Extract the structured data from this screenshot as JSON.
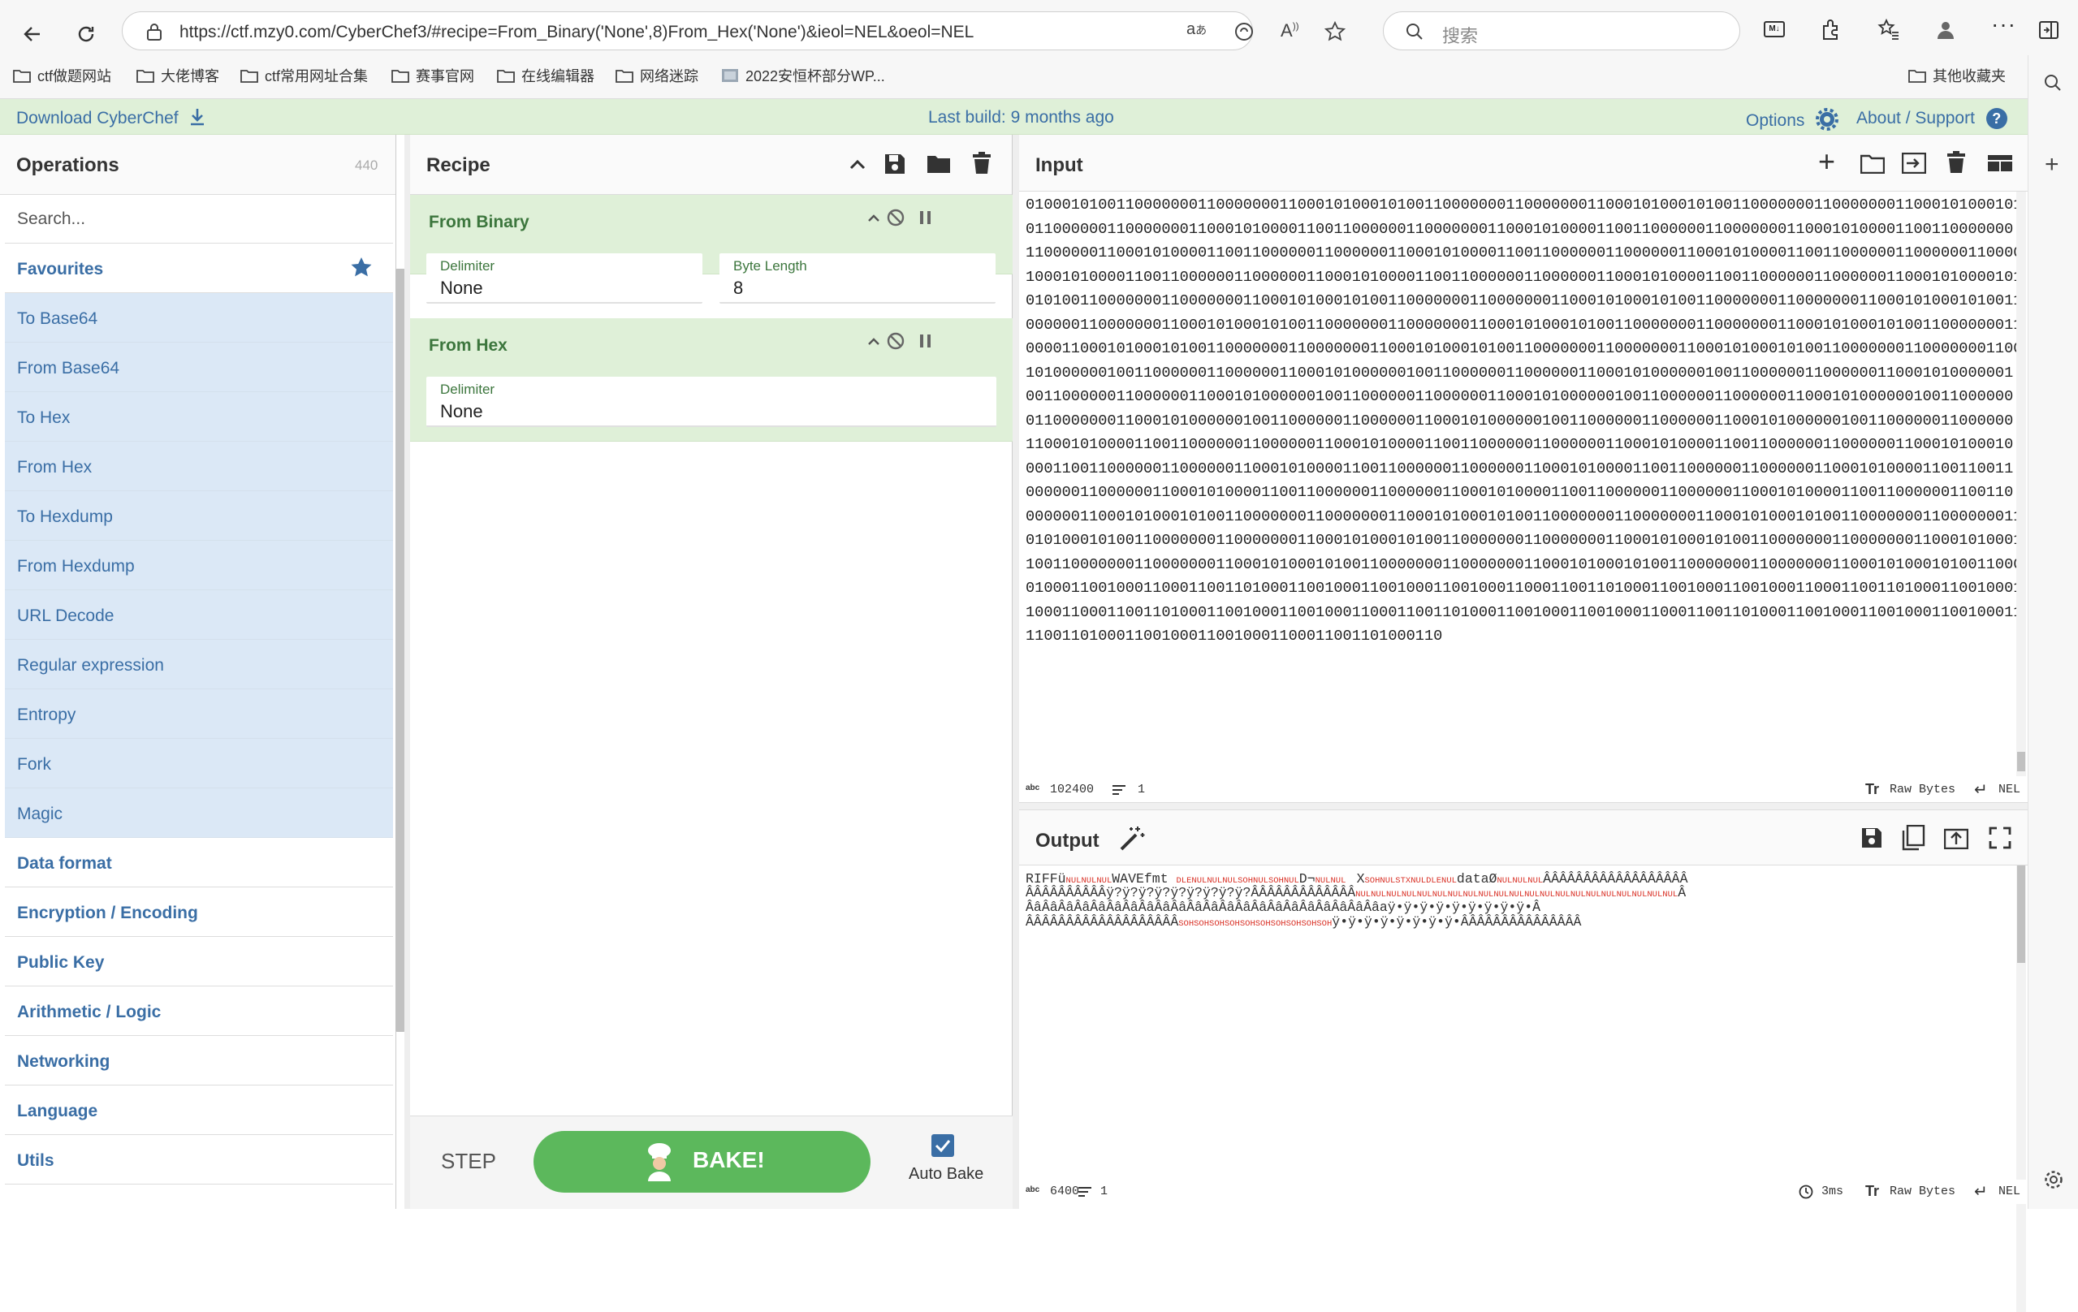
{
  "browser": {
    "url": "https://ctf.mzy0.com/CyberChef3/#recipe=From_Binary('None',8)From_Hex('None')&ieol=NEL&oeol=NEL",
    "search_placeholder": "搜索",
    "bookmarks": [
      "ctf做题网站",
      "大佬博客",
      "ctf常用网址合集",
      "赛事官网",
      "在线编辑器",
      "网络迷踪",
      "2022安恒杯部分WP..."
    ],
    "other_bookmarks": "其他收藏夹"
  },
  "banner": {
    "download": "Download CyberChef",
    "build": "Last build: 9 months ago",
    "options": "Options",
    "about": "About / Support"
  },
  "operations": {
    "title": "Operations",
    "count": "440",
    "search_placeholder": "Search...",
    "favourites": "Favourites",
    "items": [
      "To Base64",
      "From Base64",
      "To Hex",
      "From Hex",
      "To Hexdump",
      "From Hexdump",
      "URL Decode",
      "Regular expression",
      "Entropy",
      "Fork",
      "Magic"
    ],
    "categories": [
      "Data format",
      "Encryption / Encoding",
      "Public Key",
      "Arithmetic / Logic",
      "Networking",
      "Language",
      "Utils"
    ]
  },
  "recipe": {
    "title": "Recipe",
    "ops": [
      {
        "name": "From Binary",
        "fields": [
          {
            "label": "Delimiter",
            "value": "None"
          },
          {
            "label": "Byte Length",
            "value": "8"
          }
        ]
      },
      {
        "name": "From Hex",
        "fields": [
          {
            "label": "Delimiter",
            "value": "None"
          }
        ]
      }
    ],
    "step": "STEP",
    "bake": "BAKE!",
    "auto_bake": "Auto Bake"
  },
  "input": {
    "title": "Input",
    "lines": [
      "0100010100110000000110000000110001010001010011000000011000000011000101000101001100000001100000001100010100010100",
      "0110000001100000001100010100001100110000001100000001100010100001100110000001100000001100010100001100110000000",
      "1100000011000101000011001100000011000000110001010000110011000000110000001100010100001100110000001100000011000001",
      "1000101000011001100000011000000110001010000110011000000110000001100010100001100110000001100000011000101000010100",
      "0101001100000001100000001100010100010100110000000110000000110001010001010011000000011000000011000101000101001100110",
      "0000001100000001100010100010100110000000110000000110001010001010011000000011000000011000101000101001100000001100",
      "0000110001010001010011000000011000000011000101000101001100000001100000001100010100010100110000000110000000110000",
      "1010000001001100000011000000110001010000001001100000011000000110001010000001001100000011000000110001010000001",
      "0011000000110000001100010100000010011000000110000001100010100000010011000000110000001100010100000010011000000",
      "0110000000110001010000001001100000011000000110001010000001001100000011000000110001010000001001100000011000000",
      "1100010100001100110000001100000011000101000011001100000011000000110001010000110011000000110000001100010100010",
      "0001100110000001100000011000101000011001100000011000000110001010000110011000000110000001100010100001100110011",
      "0000001100000011000101000011001100000011000000110001010000110011000000110000001100010100001100110000001100110",
      "0000001100010100010100110000000110000000110001010001010011000000011000000011000101000101001100000001100000001100",
      "0101000101001100000001100000001100010100010100110000000110000000110001010001010011000000011000000011000101000100110",
      "1001100000001100000001100010100010100110000000110000000110001010001010011000000011000000011000101000101001100000",
      "0100011001000110001100110100011001000110010001100100011000110011010001100100011001000110001100110100011001000110",
      "1000110001100110100011001000110010001100011001101000110010001100100011000110011010001100100011001000110010001100",
      "1100110100011001000110010001100011001101000110"
    ],
    "length": "102400",
    "lines_count": "1",
    "raw_bytes": "Raw Bytes",
    "eol": "NEL"
  },
  "output": {
    "title": "Output",
    "lines": [
      "RIFFü\u0000\u0000\u0000WAVEfmt \u0010\u0000\u0000\u0000\u0001\u0000\u0001\u0000D¬\u0000\u0000X\u0001\u0000\u0002\u0000\u0010\u0000dataØ\u0000\u0000\u0000ÂÂÂÂÂÂÂÂÂÂÂÂÂÂÂÂÂÂ",
      "ÂÂÂÂÂÂÂÂÂÂÿ?ÿ?ÿ?ÿ?ÿ?ÿ?ÿ?ÿ?ÿ?ÂÂÂÂÂÂÂÂÂÂÂÂÂ\u0000\u0000\u0000\u0000\u0000\u0000\u0000\u0000\u0000\u0000\u0000\u0000\u0000\u0000\u0000\u0000\u0000\u0000\u0000\u0000\u0000Â",
      "ÂâÂâÂâÂâÂâÂâÂâÂâÂâÂâÂâÂâÂâÂâÂâÂâÂâÂâÂâÂâÂâÂâaÿ•ÿ•ÿ•ÿ•ÿ•ÿ•ÿ•ÿ•ÿ•Â",
      "ÂÂÂÂÂÂÂÂÂÂÂÂÂÂÂÂÂÂÂ\u0001\u0001\u0001\u0001\u0001\u0001\u0001\u0001\u0001\u0001ÿ•ÿ•ÿ•ÿ•ÿ•ÿ•ÿ•ÿ•ÂÂÂÂÂÂÂÂÂÂÂÂÂÂÂ"
    ],
    "length": "6400",
    "lines_count": "1",
    "time": "3ms",
    "raw_bytes": "Raw Bytes",
    "eol": "NEL"
  }
}
